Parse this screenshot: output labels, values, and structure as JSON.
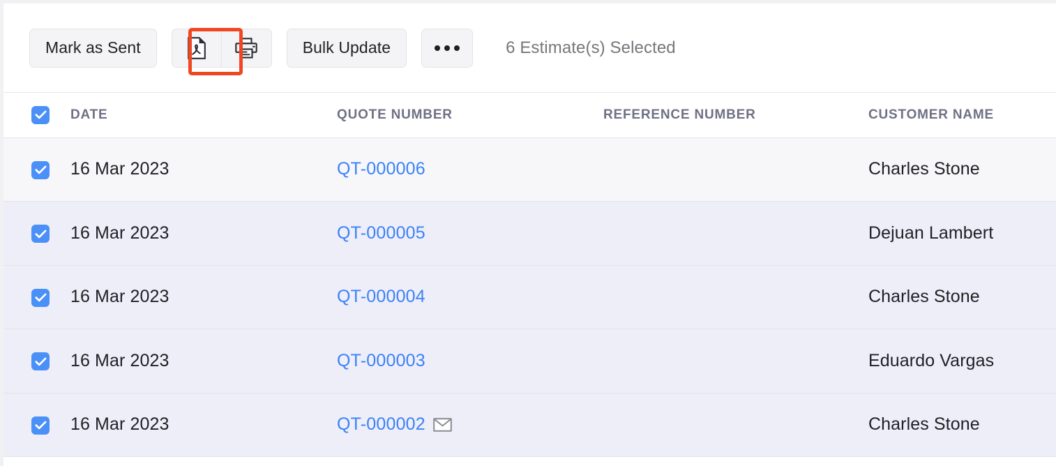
{
  "toolbar": {
    "mark_as_sent_label": "Mark as Sent",
    "pdf_icon_name": "pdf-icon",
    "print_icon_name": "print-icon",
    "bulk_update_label": "Bulk Update",
    "more_label": "•••",
    "selected_count_text": "6 Estimate(s) Selected",
    "highlight_color": "#f04622"
  },
  "table": {
    "headers": {
      "date": "DATE",
      "quote_number": "QUOTE NUMBER",
      "reference_number": "REFERENCE NUMBER",
      "customer_name": "CUSTOMER NAME"
    },
    "select_all_checked": true,
    "rows": [
      {
        "checked": true,
        "date": "16 Mar 2023",
        "quote_number": "QT-000006",
        "reference_number": "",
        "customer_name": "Charles Stone",
        "has_mail_icon": false
      },
      {
        "checked": true,
        "date": "16 Mar 2023",
        "quote_number": "QT-000005",
        "reference_number": "",
        "customer_name": "Dejuan Lambert",
        "has_mail_icon": false
      },
      {
        "checked": true,
        "date": "16 Mar 2023",
        "quote_number": "QT-000004",
        "reference_number": "",
        "customer_name": "Charles Stone",
        "has_mail_icon": false
      },
      {
        "checked": true,
        "date": "16 Mar 2023",
        "quote_number": "QT-000003",
        "reference_number": "",
        "customer_name": "Eduardo Vargas",
        "has_mail_icon": false
      },
      {
        "checked": true,
        "date": "16 Mar 2023",
        "quote_number": "QT-000002",
        "reference_number": "",
        "customer_name": "Charles Stone",
        "has_mail_icon": true
      }
    ]
  },
  "colors": {
    "link": "#3b82f6",
    "checkbox": "#4a90f7",
    "selected_row": "#eeeef8",
    "first_row": "#f7f7fa",
    "header_text": "#6f7085"
  }
}
